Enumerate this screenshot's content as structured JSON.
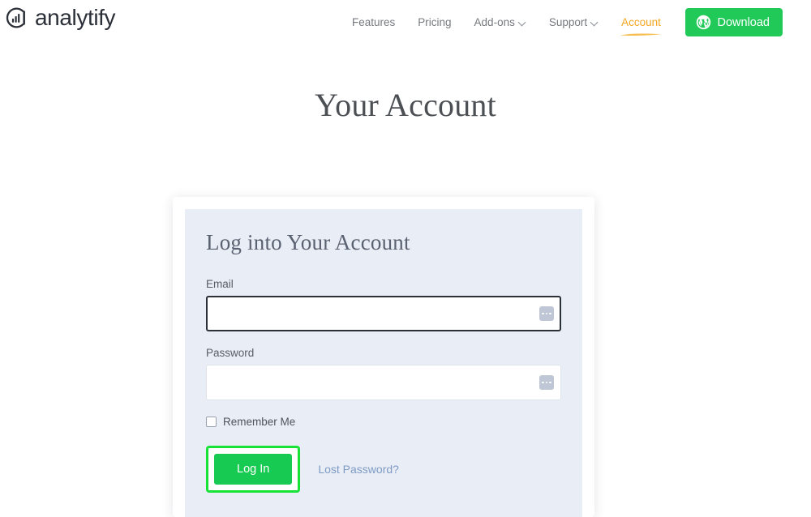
{
  "header": {
    "brand_name": "analytify",
    "brand_icon": "analytify-logo-icon",
    "nav": [
      {
        "label": "Features",
        "has_caret": false,
        "active": false
      },
      {
        "label": "Pricing",
        "has_caret": false,
        "active": false
      },
      {
        "label": "Add-ons",
        "has_caret": true,
        "active": false
      },
      {
        "label": "Support",
        "has_caret": true,
        "active": false
      },
      {
        "label": "Account",
        "has_caret": false,
        "active": true
      }
    ],
    "download_label": "Download",
    "download_icon": "wordpress-icon",
    "download_color": "#20c958",
    "active_nav_color": "#f5a623"
  },
  "page": {
    "title": "Your Account"
  },
  "login_form": {
    "heading": "Log into Your Account",
    "email": {
      "label": "Email",
      "value": "",
      "placeholder": "",
      "focused": true,
      "autofill_icon": "autofill-dots-icon"
    },
    "password": {
      "label": "Password",
      "value": "",
      "placeholder": "",
      "focused": false,
      "autofill_icon": "autofill-dots-icon"
    },
    "remember": {
      "label": "Remember Me",
      "checked": false
    },
    "submit_label": "Log In",
    "submit_color": "#17ca52",
    "lost_password_label": "Lost Password?",
    "lost_password_color": "#7d9bc4",
    "highlight_color": "#16e336",
    "panel_bg": "#e9edf6"
  }
}
